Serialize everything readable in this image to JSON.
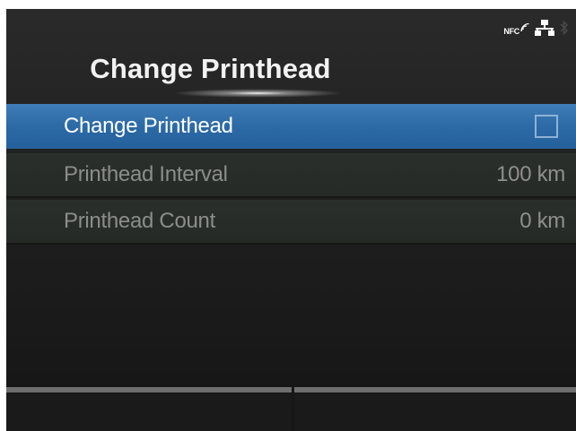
{
  "header": {
    "title": "Change Printhead",
    "status_icons": [
      "nfc-icon",
      "network-icon",
      "bluetooth-icon"
    ],
    "nfc_label": "NFC"
  },
  "menu": {
    "items": [
      {
        "label": "Change Printhead",
        "control": "checkbox",
        "checked": false,
        "selected": true
      },
      {
        "label": "Printhead Interval",
        "value": "100 km",
        "selected": false
      },
      {
        "label": "Printhead Count",
        "value": "0 km",
        "selected": false
      }
    ]
  },
  "softkeys": {
    "left_label": "",
    "right_label": ""
  },
  "colors": {
    "background": "#1f1f1f",
    "selection": "#2c6aa6",
    "text_primary": "#ffffff",
    "text_disabled": "#8b8d8a",
    "softkey_bar": "#6e6e6e"
  }
}
